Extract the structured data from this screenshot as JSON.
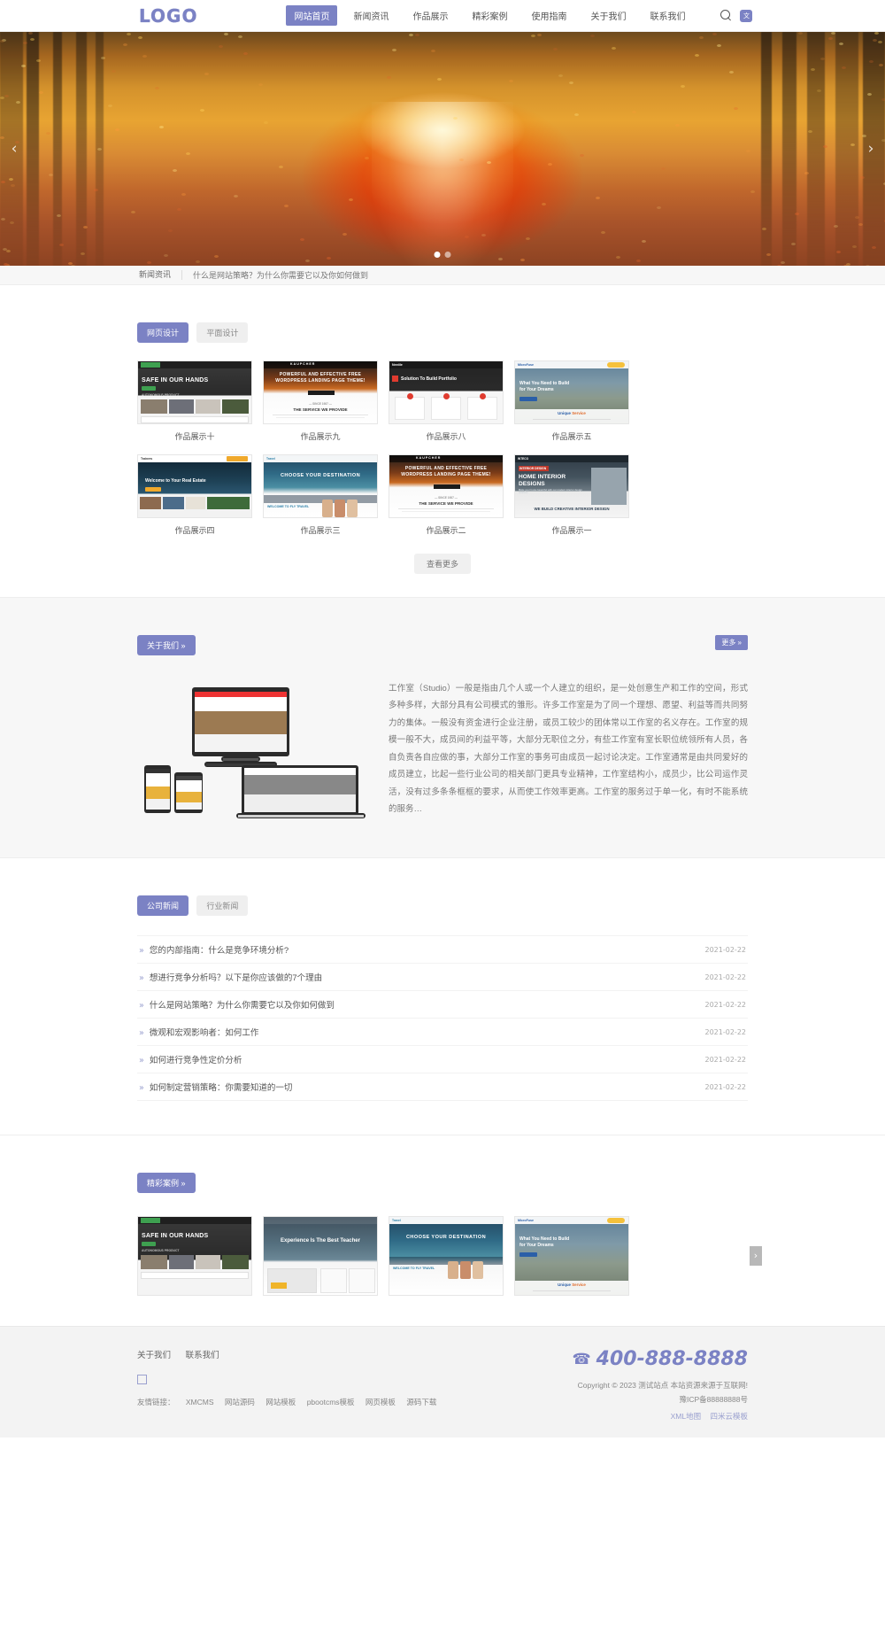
{
  "header": {
    "logo": "LOGO",
    "nav": [
      {
        "label": "网站首页",
        "active": true
      },
      {
        "label": "新闻资讯",
        "active": false
      },
      {
        "label": "作品展示",
        "active": false
      },
      {
        "label": "精彩案例",
        "active": false
      },
      {
        "label": "使用指南",
        "active": false
      },
      {
        "label": "关于我们",
        "active": false
      },
      {
        "label": "联系我们",
        "active": false
      }
    ],
    "search_icon": "search-icon",
    "lang_badge": "文",
    "accent": "#7b82c4"
  },
  "hero": {
    "prev": "‹",
    "next": "›",
    "dots": [
      true,
      false
    ],
    "alt": "autumn-forest-path-slide"
  },
  "ticker": {
    "label": "新闻资讯",
    "text": "什么是网站策略？为什么你需要它以及你如何做到"
  },
  "portfolio": {
    "tabs": [
      {
        "label": "网页设计",
        "active": true
      },
      {
        "label": "平面设计",
        "active": false
      }
    ],
    "items": [
      {
        "caption": "作品展示十",
        "theme": "safe-hands-auto",
        "headline": "SAFE IN OUR HANDS",
        "sub": "AUTONOMOUS PRODUCT",
        "cta": "READ MORE"
      },
      {
        "caption": "作品展示九",
        "theme": "kaupcher-dark",
        "headline": "POWERFUL AND EFFECTIVE FREE WORDPRESS LANDING PAGE THEME!",
        "sub": "THE SERVICE WE PROVIDE",
        "cta": "READ MORE"
      },
      {
        "caption": "作品展示八",
        "theme": "nextile-red",
        "headline": "Solution To Build Portfolio",
        "sub": "",
        "cta": ""
      },
      {
        "caption": "作品展示五",
        "theme": "microfuse-bridge",
        "headline": "What You Need to Build for Your Dreams",
        "sub": "Unique Service",
        "cta": ""
      },
      {
        "caption": "作品展示四",
        "theme": "realestate-welcome",
        "headline": "Welcome to Your Real Estate",
        "sub": "Trainers",
        "cta": ""
      },
      {
        "caption": "作品展示三",
        "theme": "travel-destination",
        "headline": "CHOOSE YOUR DESTINATION",
        "sub": "WELCOME TO FLY TRAVEL",
        "cta": ""
      },
      {
        "caption": "作品展示二",
        "theme": "kaupcher-dark",
        "headline": "POWERFUL AND EFFECTIVE FREE WORDPRESS LANDING PAGE THEME!",
        "sub": "THE SERVICE WE PROVIDE",
        "cta": ""
      },
      {
        "caption": "作品展示一",
        "theme": "interior-design",
        "headline": "HOME INTERIOR DESIGNS",
        "sub": "INTERIOR DESIGN",
        "cta": "WE BUILD CREATIVE INTERIOR DESIGN"
      }
    ],
    "view_more": "查看更多"
  },
  "about": {
    "title": "关于我们 »",
    "more": "更多 »",
    "image_alt": "responsive-devices-mockup",
    "paragraph": "工作室（Studio）一般是指由几个人或一个人建立的组织，是一处创意生产和工作的空间，形式多种多样，大部分具有公司模式的雏形。许多工作室是为了同一个理想、愿望、利益等而共同努力的集体。一般没有资金进行企业注册，或员工较少的团体常以工作室的名义存在。工作室的规模一般不大，成员间的利益平等，大部分无职位之分，有些工作室有室长职位统领所有人员，各自负责各自应做的事，大部分工作室的事务可由成员一起讨论决定。工作室通常是由共同爱好的成员建立，比起一些行业公司的相关部门更具专业精神，工作室结构小，成员少，比公司运作灵活，没有过多条条框框的要求，从而使工作效率更高。工作室的服务过于单一化，有时不能系统的服务…"
  },
  "news": {
    "tabs": [
      {
        "label": "公司新闻",
        "active": true
      },
      {
        "label": "行业新闻",
        "active": false
      }
    ],
    "bullet": "»",
    "items": [
      {
        "title": "您的内部指南：什么是竞争环境分析?",
        "date": "2021-02-22"
      },
      {
        "title": "想进行竞争分析吗？以下是你应该做的7个理由",
        "date": "2021-02-22"
      },
      {
        "title": "什么是网站策略？为什么你需要它以及你如何做到",
        "date": "2021-02-22"
      },
      {
        "title": "微观和宏观影响者：如何工作",
        "date": "2021-02-22"
      },
      {
        "title": "如何进行竞争性定价分析",
        "date": "2021-02-22"
      },
      {
        "title": "如何制定营销策略：你需要知道的一切",
        "date": "2021-02-22"
      }
    ]
  },
  "cases": {
    "title": "精彩案例 »",
    "next": "›",
    "items": [
      {
        "theme": "safe-hands-auto",
        "headline": "SAFE IN OUR HANDS",
        "sub": "AUTONOMOUS PRODUCT"
      },
      {
        "theme": "teacher-experience",
        "headline": "Experience Is The Best Teacher",
        "sub": ""
      },
      {
        "theme": "travel-destination",
        "headline": "CHOOSE YOUR DESTINATION",
        "sub": "WELCOME TO FLY TRAVEL"
      },
      {
        "theme": "microfuse-bridge",
        "headline": "What You Need to Build for Your Dreams",
        "sub": "Unique Service"
      }
    ]
  },
  "footer": {
    "links": [
      "关于我们",
      "联系我们"
    ],
    "qr_icon": "qr-code-icon",
    "friend_label": "友情链接：",
    "friend_links": [
      "XMCMS",
      "网站源码",
      "网站模板",
      "pbootcms模板",
      "网页模板",
      "源码下载"
    ],
    "phone_icon": "phone-icon",
    "phone": "400-888-8888",
    "copyright": "Copyright © 2023 测试站点 本站资源来源于互联网!",
    "icp": "豫ICP备88888888号",
    "bottom_links": [
      "XML地图",
      "四米云模板"
    ]
  }
}
